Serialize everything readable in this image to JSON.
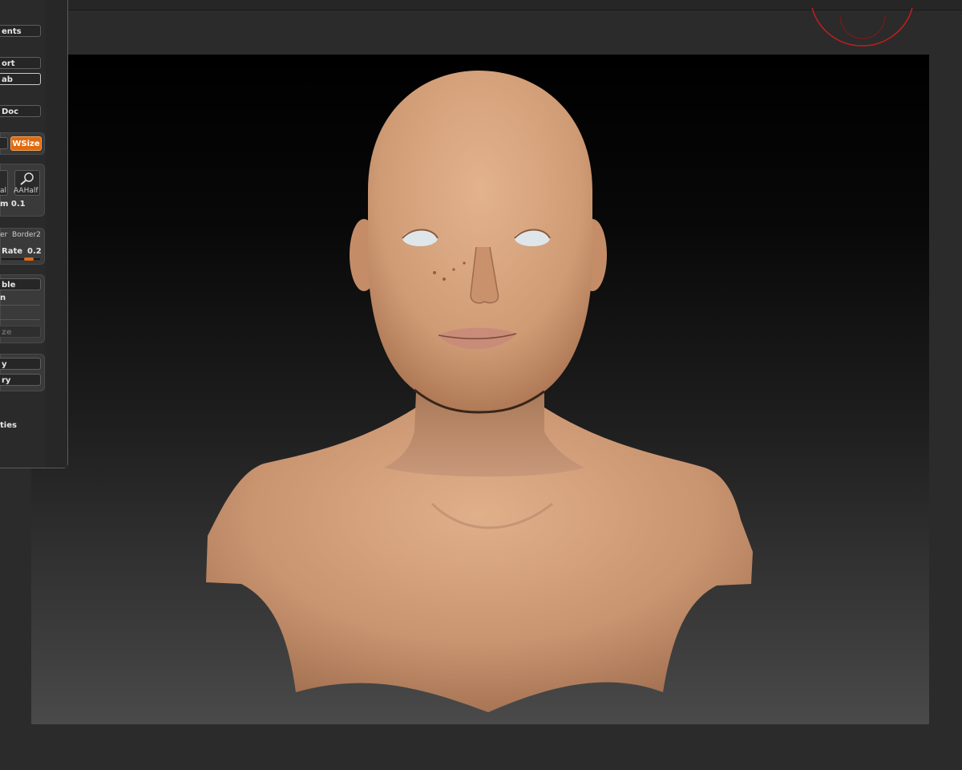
{
  "panel": {
    "items": [
      {
        "label": "ents"
      },
      {
        "label": "ort"
      },
      {
        "label": "ab"
      },
      {
        "label": "Doc"
      },
      {
        "label": "WSize"
      },
      {
        "label": "al"
      },
      {
        "label": "AAHalf"
      },
      {
        "label": "m 0.1"
      },
      {
        "label": "er"
      },
      {
        "label": "Border2"
      },
      {
        "label": "Rate"
      },
      {
        "label": "0.2"
      },
      {
        "label": "ble"
      },
      {
        "label": "n"
      },
      {
        "label": "ze"
      },
      {
        "label": "y"
      },
      {
        "label": "ry"
      },
      {
        "label": "ties"
      }
    ],
    "rate_value": 0.2
  },
  "viewport": {
    "model": "female-bust-sculpt",
    "background": "black-to-gray-gradient"
  },
  "colors": {
    "accent": "#e06a10",
    "skin": "#c99772",
    "gizmo": "#c41e1e"
  }
}
